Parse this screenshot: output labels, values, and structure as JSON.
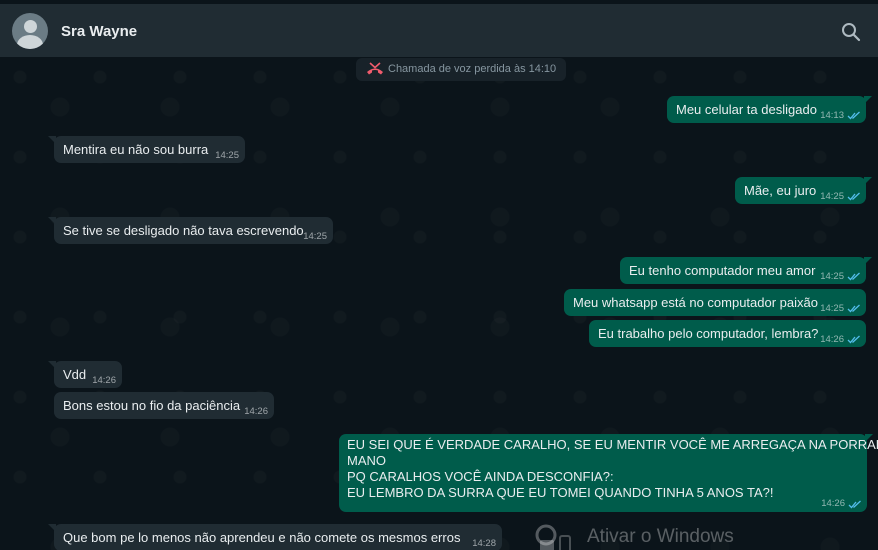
{
  "header": {
    "contact_name": "Sra Wayne"
  },
  "system": {
    "missed_call": "Chamada de voz perdida às 14:10"
  },
  "messages": [
    {
      "dir": "out",
      "text": "Meu celular ta desligado",
      "time": "14:13"
    },
    {
      "dir": "in",
      "text": "Mentira eu não  sou burra",
      "time": "14:25"
    },
    {
      "dir": "out",
      "text": "Mãe, eu juro",
      "time": "14:25"
    },
    {
      "dir": "in",
      "text": "Se tive se desligado não  tava escrevendo",
      "time": "14:25"
    },
    {
      "dir": "out",
      "text": "Eu tenho computador meu amor",
      "time": "14:25"
    },
    {
      "dir": "out",
      "text": "Meu whatsapp está no computador paixão",
      "time": "14:25"
    },
    {
      "dir": "out",
      "text": "Eu trabalho pelo computador, lembra?",
      "time": "14:26"
    },
    {
      "dir": "in",
      "text": "Vdd",
      "time": "14:26"
    },
    {
      "dir": "in",
      "text": "Bons  estou no fio da paciência",
      "time": "14:26"
    },
    {
      "dir": "out",
      "lines": [
        "EU SEI QUE É VERDADE CARALHO, SE EU MENTIR VOCÊ ME ARREGAÇA NA PORRADA",
        "MANO",
        "PQ CARALHOS VOCÊ AINDA DESCONFIA?:",
        "EU LEMBRO DA SURRA QUE EU TOMEI QUANDO TINHA 5 ANOS TA?!"
      ],
      "time": "14:26"
    },
    {
      "dir": "in",
      "text": "Que  bom pe lo menos não  aprendeu  e não  comete os mesmos  erros",
      "time": "14:28"
    }
  ],
  "watermark": {
    "text": "Ativar o Windows"
  },
  "colors": {
    "background": "#0b141a",
    "header": "#202c33",
    "incoming_bubble": "#202c33",
    "outgoing_bubble": "#005c4b",
    "read_tick": "#53bdeb",
    "missed_call_icon": "#f15c6d"
  },
  "icons": {
    "search": "search-icon",
    "avatar": "default-avatar-icon",
    "missed_call": "missed-call-icon",
    "read_receipt": "double-check-icon"
  }
}
